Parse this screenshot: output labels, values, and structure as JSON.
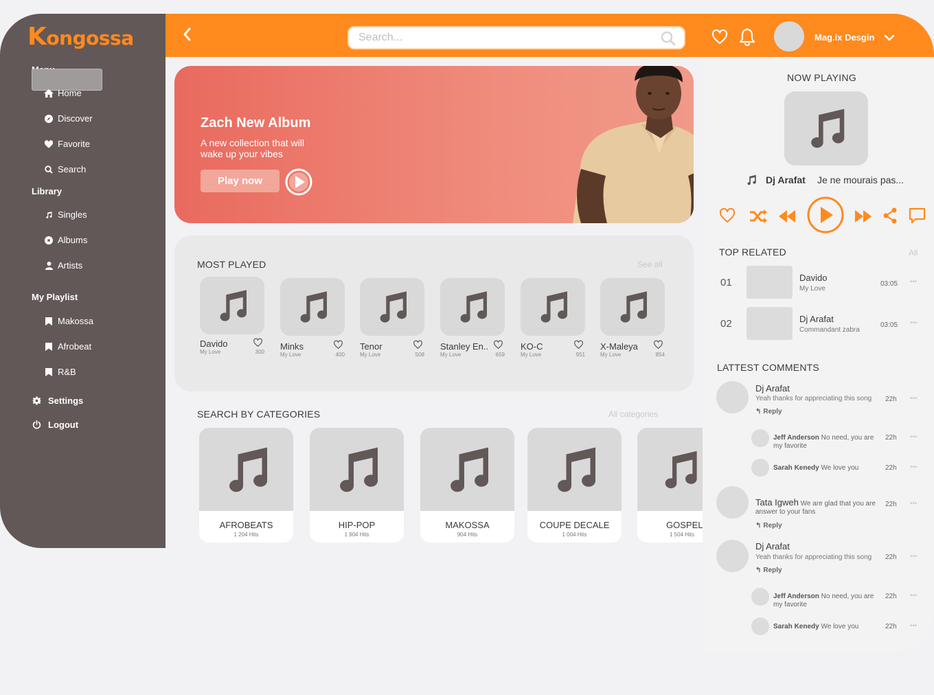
{
  "brand": {
    "logo_k": "K",
    "logo_rest": "ongossa",
    "accent": "#ff8a1e",
    "sidebar_bg": "#625858"
  },
  "sidebar": {
    "menu_heading": "Menu",
    "menu": [
      {
        "label": "Home",
        "icon": "home-icon"
      },
      {
        "label": "Discover",
        "icon": "compass-icon"
      },
      {
        "label": "Favorite",
        "icon": "heart-icon"
      },
      {
        "label": "Search",
        "icon": "search-icon"
      }
    ],
    "library_heading": "Library",
    "library": [
      {
        "label": "Singles",
        "icon": "music-note-icon"
      },
      {
        "label": "Albums",
        "icon": "disc-icon"
      },
      {
        "label": "Artists",
        "icon": "user-icon"
      }
    ],
    "playlist_heading": "My Playlist",
    "playlists": [
      {
        "label": "Makossa",
        "icon": "bookmark-icon"
      },
      {
        "label": "Afrobeat",
        "icon": "bookmark-icon"
      },
      {
        "label": "R&B",
        "icon": "bookmark-icon"
      }
    ],
    "settings": "Settings",
    "logout": "Logout"
  },
  "header": {
    "search_placeholder": "Search...",
    "username": "Mag.ix Desgin"
  },
  "hero": {
    "title": "Zach New Album",
    "subtitle": "A new collection that will wake up your vibes",
    "button": "Play now"
  },
  "most_played": {
    "title": "MOST PLAYED",
    "see_all": "See all",
    "items": [
      {
        "name": "Davido",
        "sub": "My Love",
        "count": "300"
      },
      {
        "name": "Minks",
        "sub": "My Love",
        "count": "400"
      },
      {
        "name": "Tenor",
        "sub": "My Love",
        "count": "508"
      },
      {
        "name": "Stanley En..",
        "sub": "My Love",
        "count": "659"
      },
      {
        "name": "KO-C",
        "sub": "My Love",
        "count": "951"
      },
      {
        "name": "X-Maleya",
        "sub": "My Love",
        "count": "854"
      }
    ]
  },
  "categories": {
    "title": "SEARCH BY CATEGORIES",
    "all": "All categories",
    "items": [
      {
        "name": "AFROBEATS",
        "hits": "1 204 Hits"
      },
      {
        "name": "HIP-POP",
        "hits": "1 904 Hits"
      },
      {
        "name": "MAKOSSA",
        "hits": "904 Hits"
      },
      {
        "name": "COUPE DECALE",
        "hits": "1 004 Hits"
      },
      {
        "name": "GOSPEL",
        "hits": "1 504 Hits"
      }
    ]
  },
  "now_playing": {
    "title": "NOW PLAYING",
    "artist": "Dj Arafat",
    "song": "Je ne mourais pas..."
  },
  "top_related": {
    "title": "TOP RELATED",
    "all": "All",
    "items": [
      {
        "num": "01",
        "artist": "Davido",
        "song": "My Love",
        "time": "03:05"
      },
      {
        "num": "02",
        "artist": "Dj Arafat",
        "song": "Commandant zabra",
        "time": "03:05"
      }
    ]
  },
  "comments": {
    "title": "LATTEST COMMENTS",
    "reply": "Reply",
    "threads": [
      {
        "name": "Dj Arafat",
        "text": "Yeah thanks for appreciating this song",
        "time": "22h",
        "replies": [
          {
            "name": "Jeff Anderson",
            "text": "No need, you are my favorite",
            "time": "22h"
          },
          {
            "name": "Sarah Kenedy",
            "text": "We love you",
            "time": "22h"
          }
        ]
      },
      {
        "name": "Tata Igweh",
        "text": "We are glad that you are answer to your fans",
        "time": "22h",
        "replies": []
      },
      {
        "name": "Dj Arafat",
        "text": "Yeah thanks for appreciating this song",
        "time": "22h",
        "replies": [
          {
            "name": "Jeff Anderson",
            "text": "No need, you are my favorite",
            "time": "22h"
          },
          {
            "name": "Sarah Kenedy",
            "text": "We love you",
            "time": "22h"
          }
        ]
      }
    ]
  }
}
